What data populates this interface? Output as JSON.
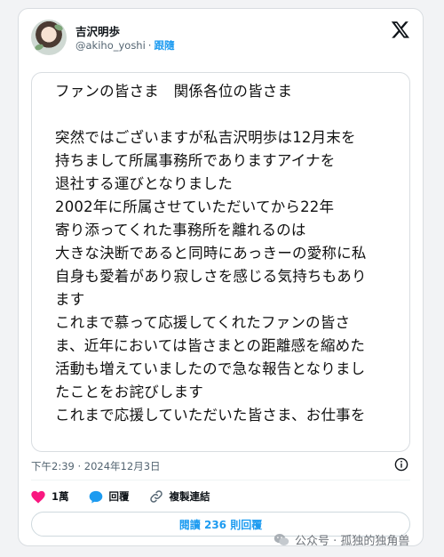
{
  "author": {
    "display_name": "吉沢明歩",
    "handle": "@akiho_yoshi",
    "separator": "·",
    "follow_label": "跟隨"
  },
  "post": {
    "lines": [
      "ファンの皆さま　関係各位の皆さま",
      "",
      "突然ではございますが私吉沢明歩は12月末を",
      "持ちまして所属事務所でありますアイナを",
      "退社する運びとなりました",
      "2002年に所属させていただいてから22年",
      "寄り添ってくれた事務所を離れるのは",
      "大きな決断であると同時にあっきーの愛称に私",
      "自身も愛着があり寂しさを感じる気持ちもあり",
      "ます",
      "これまで慕って応援してくれたファンの皆さ",
      "ま、近年においては皆さまとの距離感を縮めた",
      "活動も増えていましたので急な報告となりまし",
      "たことをお詫びします",
      "これまで応援していただいた皆さま、お仕事を"
    ],
    "timestamp": "下午2:39 · 2024年12月3日"
  },
  "actions": {
    "like_count": "1萬",
    "reply_label": "回覆",
    "copy_link_label": "複製連結"
  },
  "read_replies_label": "閱讀 236 則回覆",
  "watermark": "公众号 · 孤独的独角兽",
  "colors": {
    "accent": "#1d9bf0",
    "like": "#f91880",
    "text": "#0f1419",
    "muted": "#536471"
  }
}
